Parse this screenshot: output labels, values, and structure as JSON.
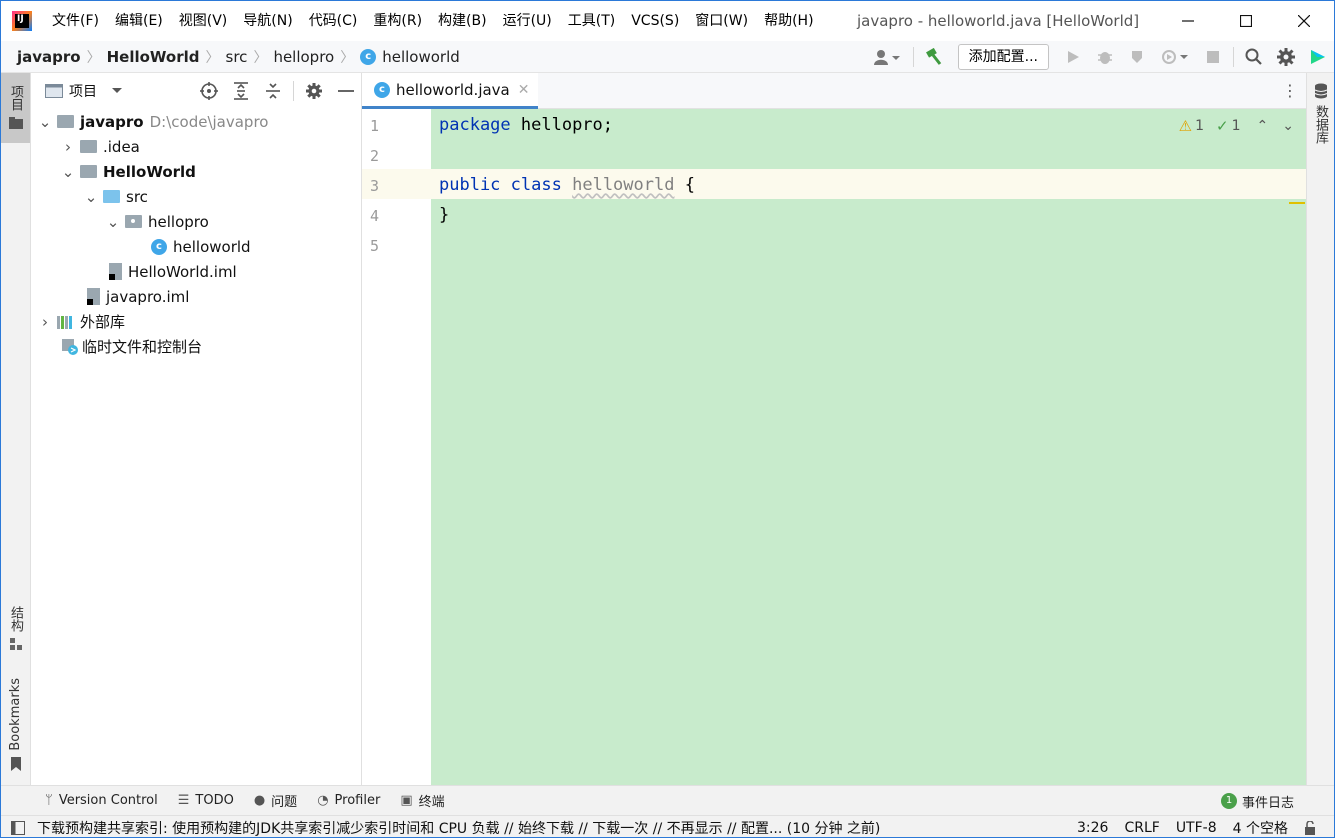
{
  "window": {
    "title": "javapro - helloworld.java [HelloWorld]",
    "logo_text": "IJ"
  },
  "menu": [
    "文件(F)",
    "编辑(E)",
    "视图(V)",
    "导航(N)",
    "代码(C)",
    "重构(R)",
    "构建(B)",
    "运行(U)",
    "工具(T)",
    "VCS(S)",
    "窗口(W)",
    "帮助(H)"
  ],
  "breadcrumb": [
    "javapro",
    "HelloWorld",
    "src",
    "hellopro",
    "helloworld"
  ],
  "toolbar": {
    "add_config_label": "添加配置..."
  },
  "left_strip": {
    "project_tab": "项目",
    "structure_tab": "结构",
    "bookmarks_tab": "Bookmarks"
  },
  "right_strip": {
    "database_tab": "数据库"
  },
  "project_panel": {
    "title": "项目",
    "tree": [
      {
        "label": "javapro",
        "hint": "D:\\code\\javapro"
      },
      {
        "label": ".idea"
      },
      {
        "label": "HelloWorld"
      },
      {
        "label": "src"
      },
      {
        "label": "hellopro"
      },
      {
        "label": "helloworld"
      },
      {
        "label": "HelloWorld.iml"
      },
      {
        "label": "javapro.iml"
      },
      {
        "label": "外部库"
      },
      {
        "label": "临时文件和控制台"
      }
    ]
  },
  "editor": {
    "tab_label": "helloworld.java",
    "line_numbers": [
      "1",
      "2",
      "3",
      "4",
      "5"
    ],
    "code": {
      "l1_kw": "package",
      "l1_rest": " hellopro;",
      "l3_kw1": "public",
      "l3_kw2": "class",
      "l3_cls": "helloworld",
      "l3_brace": " {",
      "l4": "}"
    },
    "warnings": "1",
    "checks": "1"
  },
  "tool_windows": [
    "Version Control",
    "TODO",
    "问题",
    "Profiler",
    "终端"
  ],
  "event_log": {
    "count": "1",
    "label": "事件日志"
  },
  "status": {
    "message": "下载预构建共享索引: 使用预构建的JDK共享索引减少索引时间和 CPU 负载 // 始终下载 // 下载一次 // 不再显示 // 配置... (10 分钟 之前)",
    "position": "3:26",
    "line_sep": "CRLF",
    "encoding": "UTF-8",
    "indent": "4 个空格"
  }
}
